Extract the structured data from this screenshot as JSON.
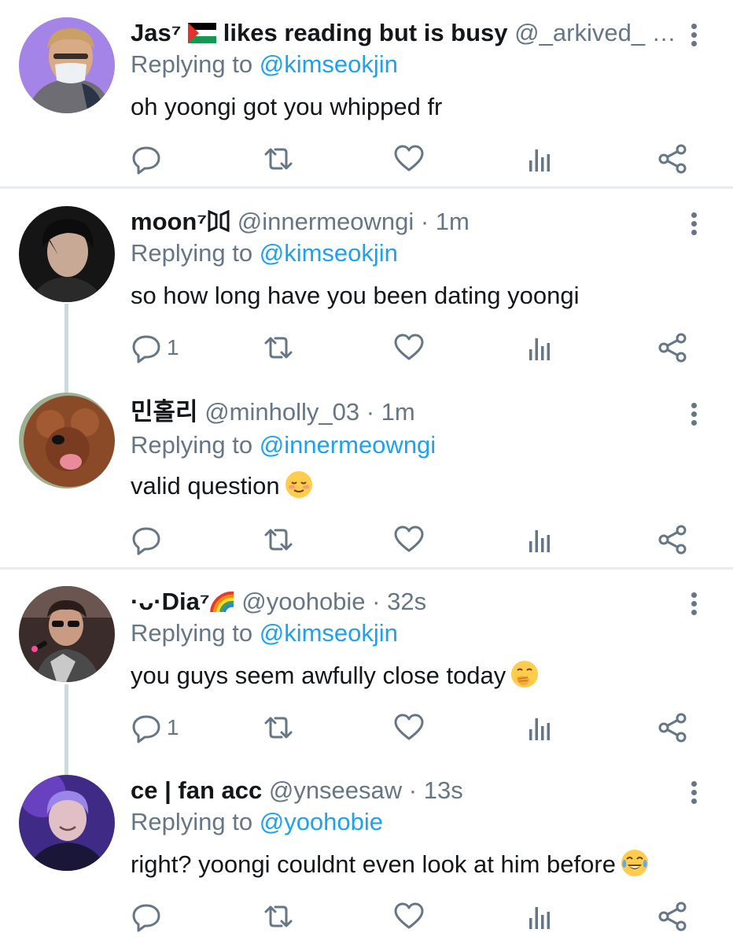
{
  "replying_prefix": "Replying to",
  "tweets": [
    {
      "name": "Jas⁷",
      "name_extra": "likes reading but is busy",
      "handle": "@_arkived_ …",
      "reply_to": "@kimseokjin",
      "text": "oh yoongi got you whipped fr",
      "reply_count": "",
      "avatar": "avatar-photo-masked-man"
    },
    {
      "name": "moon⁷",
      "handle": "@innermeowngi · 1m",
      "reply_to": "@kimseokjin",
      "text": "so how long have you been dating yoongi",
      "reply_count": "1",
      "avatar": "avatar-photo-dark-hair"
    },
    {
      "name": "민홀리",
      "handle": "@minholly_03 · 1m",
      "reply_to": "@innermeowngi",
      "text": "valid question",
      "reply_count": "",
      "avatar": "avatar-photo-dog"
    },
    {
      "name": "·ᴗ·Dia⁷",
      "handle": "@yoohobie · 32s",
      "reply_to": "@kimseokjin",
      "text": "you guys seem awfully close today",
      "reply_count": "1",
      "avatar": "avatar-photo-sunglasses"
    },
    {
      "name": "ce | fan acc",
      "handle": "@ynseesaw · 13s",
      "reply_to": "@yoohobie",
      "text": "right? yoongi couldnt even look at him before",
      "reply_count": "",
      "avatar": "avatar-photo-purple"
    }
  ],
  "icons": {
    "reply": "reply-icon",
    "retweet": "retweet-icon",
    "like": "heart-icon",
    "analytics": "analytics-icon",
    "share": "share-icon",
    "more": "more-vertical-icon"
  },
  "colors": {
    "mention": "#1da1f2",
    "secondary_text": "#657786",
    "divider": "#e6ecf0",
    "thread_line": "#cfd9de"
  }
}
